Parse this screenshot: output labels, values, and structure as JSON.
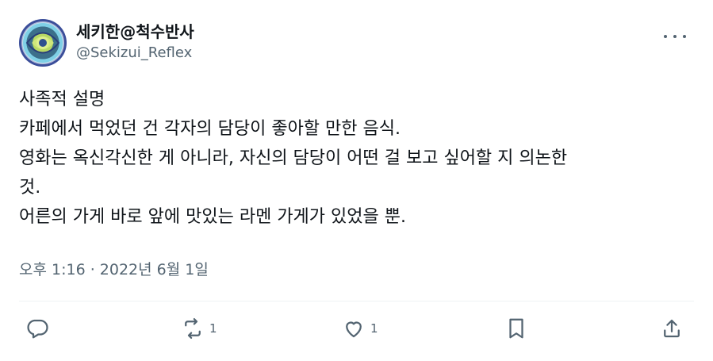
{
  "author": {
    "display_name": "세키한@척수반사",
    "handle": "@Sekizui_Reflex"
  },
  "tweet": {
    "text": "사족적 설명\n카페에서 먹었던 건 각자의 담당이 좋아할 만한 음식.\n영화는 옥신각신한 게 아니라, 자신의 담당이 어떤 걸 보고 싶어할 지 의논한\n것.\n어른의 가게 바로 앞에 맛있는 라멘 가게가 있었을 뿐.",
    "timestamp": "오후 1:16 · 2022년 6월 1일"
  },
  "actions": {
    "reply": {
      "icon": "reply-icon",
      "count": ""
    },
    "retweet": {
      "icon": "retweet-icon",
      "count": "1"
    },
    "like": {
      "icon": "heart-icon",
      "count": "1"
    },
    "bookmark": {
      "icon": "bookmark-icon",
      "count": ""
    },
    "share": {
      "icon": "share-icon",
      "count": ""
    }
  },
  "colors": {
    "text": "#0f1419",
    "secondary": "#536471",
    "divider": "#eff3f4"
  }
}
